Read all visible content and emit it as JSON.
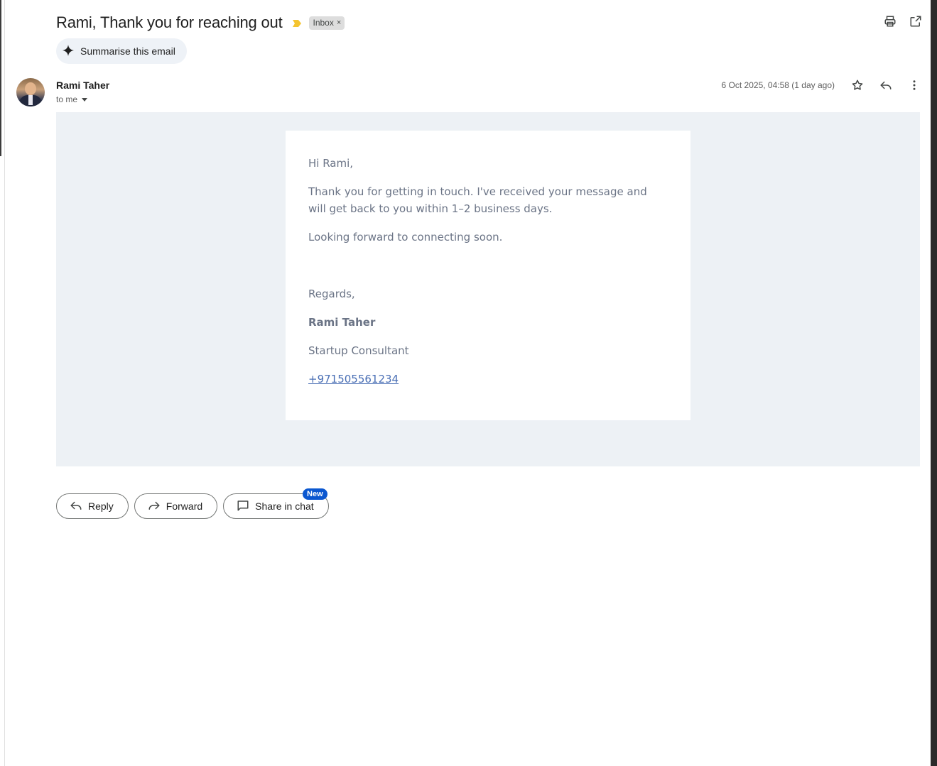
{
  "email": {
    "subject": "Rami, Thank you for reaching out",
    "label_chip": "Inbox",
    "label_chip_close": "×",
    "summarise_label": "Summarise this email",
    "sender_name": "Rami Taher",
    "recipient": "to me",
    "date": "6 Oct 2025, 04:58 (1 day ago)"
  },
  "body": {
    "greeting": "Hi Rami,",
    "paragraph1": "Thank you for getting in touch. I've received your message and will get back to you within 1–2 business days.",
    "paragraph2": "Looking forward to connecting soon.",
    "regards": "Regards,",
    "signature_name": "Rami Taher",
    "signature_title": "Startup Consultant",
    "signature_phone": "+971505561234"
  },
  "actions": {
    "reply": "Reply",
    "forward": "Forward",
    "share": "Share in chat",
    "new_badge": "New"
  },
  "icons": {
    "print": "print-icon",
    "popout": "open-in-new-window-icon",
    "star": "star-icon",
    "reply": "reply-icon",
    "more": "more-vert-icon",
    "sparkle": "sparkle-icon",
    "importance": "importance-marker-icon",
    "forward": "forward-icon",
    "chat": "chat-bubble-icon"
  },
  "colors": {
    "importance": "#f4c430",
    "new_badge": "#0b57d0",
    "email_background": "#edf1f5",
    "link": "#4a6fb5"
  }
}
